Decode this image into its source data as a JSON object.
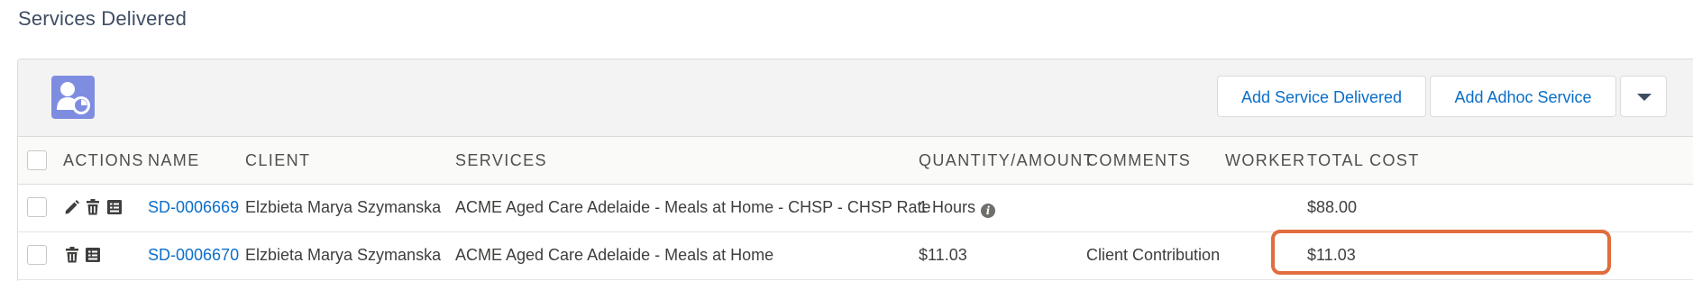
{
  "section": {
    "title": "Services Delivered"
  },
  "header": {
    "icon": "client-service-icon",
    "buttons": {
      "add_service_delivered": "Add Service Delivered",
      "add_adhoc_service": "Add Adhoc Service",
      "menu_icon": "chevron-down-icon"
    }
  },
  "table": {
    "columns": {
      "actions": "ACTIONS",
      "name": "NAME",
      "client": "CLIENT",
      "services": "SERVICES",
      "quantity": "QUANTITY/AMOUNT",
      "comments": "COMMENTS",
      "worker": "WORKER",
      "total_cost": "TOTAL COST"
    },
    "rows": [
      {
        "actions": [
          "edit-icon",
          "delete-icon",
          "details-icon"
        ],
        "name": "SD-0006669",
        "client": "Elzbieta Marya Szymanska",
        "services": "ACME Aged Care Adelaide - Meals at Home - CHSP - CHSP Rate",
        "quantity": "1 Hours",
        "comments": "",
        "worker": "",
        "total_cost": "$88.00"
      },
      {
        "actions": [
          "delete-icon",
          "details-icon"
        ],
        "name": "SD-0006670",
        "client": "Elzbieta Marya Szymanska",
        "services": "ACME Aged Care Adelaide - Meals at Home",
        "quantity": "$11.03",
        "comments": "Client Contribution",
        "worker": "",
        "total_cost": "$11.03"
      }
    ]
  },
  "colors": {
    "link": "#0b6ec9",
    "icon_bg": "#7f8de1",
    "highlight": "#e06d3d"
  }
}
